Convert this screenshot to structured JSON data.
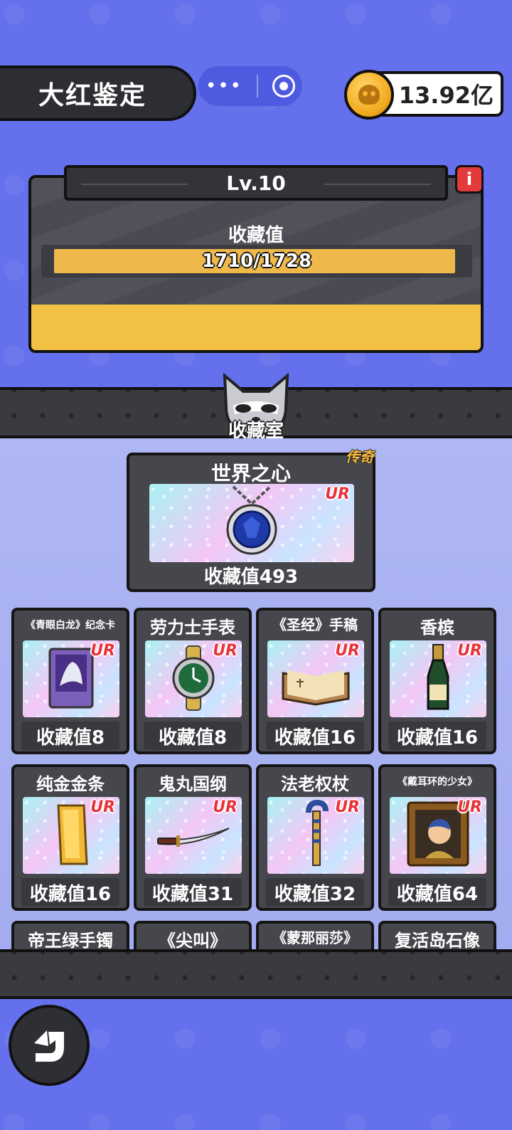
{
  "header": {
    "title": "大红鉴定",
    "coin_balance": "13.92亿"
  },
  "level": {
    "label": "Lv.10",
    "info_icon": "i",
    "collect_label": "收藏值",
    "progress_text": "1710/1728",
    "progress_fraction": 0.9896
  },
  "room": {
    "label": "收藏室"
  },
  "featured": {
    "name": "世界之心",
    "rarity": "UR",
    "tier": "传奇",
    "value_text": "收藏值493",
    "icon": "sapphire-necklace-icon"
  },
  "items": [
    {
      "name": "《青眼白龙》纪念卡",
      "rarity": "UR",
      "value_text": "收藏值8",
      "icon": "dragon-card-icon"
    },
    {
      "name": "劳力士手表",
      "rarity": "UR",
      "value_text": "收藏值8",
      "icon": "watch-icon"
    },
    {
      "name": "《圣经》手稿",
      "rarity": "UR",
      "value_text": "收藏值16",
      "icon": "book-icon"
    },
    {
      "name": "香槟",
      "rarity": "UR",
      "value_text": "收藏值16",
      "icon": "champagne-icon"
    },
    {
      "name": "纯金金条",
      "rarity": "UR",
      "value_text": "收藏值16",
      "icon": "gold-bar-icon"
    },
    {
      "name": "鬼丸国纲",
      "rarity": "UR",
      "value_text": "收藏值31",
      "icon": "katana-icon"
    },
    {
      "name": "法老权杖",
      "rarity": "UR",
      "value_text": "收藏值32",
      "icon": "scepter-icon"
    },
    {
      "name": "《戴耳环的少女》",
      "rarity": "UR",
      "value_text": "收藏值64",
      "icon": "painting-icon"
    },
    {
      "name": "帝王绿手镯",
      "rarity": "",
      "value_text": "",
      "icon": ""
    },
    {
      "name": "《尖叫》",
      "rarity": "",
      "value_text": "",
      "icon": ""
    },
    {
      "name": "《蒙那丽莎》",
      "rarity": "",
      "value_text": "",
      "icon": ""
    },
    {
      "name": "复活岛石像",
      "rarity": "",
      "value_text": "",
      "icon": ""
    }
  ],
  "colors": {
    "background": "#6470ec",
    "panel": "#4a4b52",
    "accent_yellow": "#f2c144",
    "rarity_red": "#e8333a",
    "legend_gold": "#f5b93a"
  }
}
